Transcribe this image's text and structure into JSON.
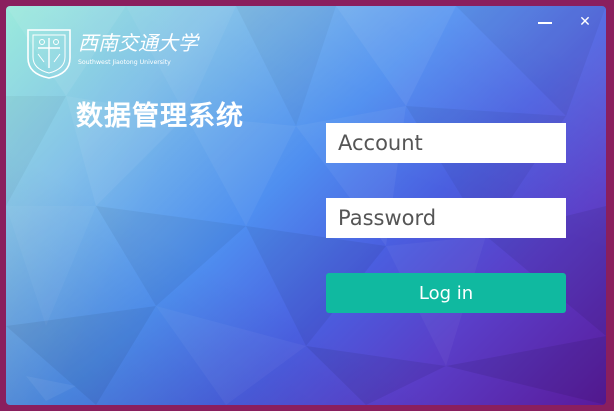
{
  "window": {
    "minimize_label": "",
    "close_label": "✕"
  },
  "logo": {
    "university_name_cn": "西南交通大学",
    "university_name_en": "Southwest Jiaotong University"
  },
  "title": "数据管理系统",
  "form": {
    "account_placeholder": "Account",
    "password_placeholder": "Password",
    "login_label": "Log in"
  },
  "colors": {
    "accent": "#10b9a0",
    "frame": "#8a1f5e"
  },
  "icons": {
    "minimize": "minimize-icon",
    "close": "close-icon",
    "logo": "university-seal-icon"
  }
}
